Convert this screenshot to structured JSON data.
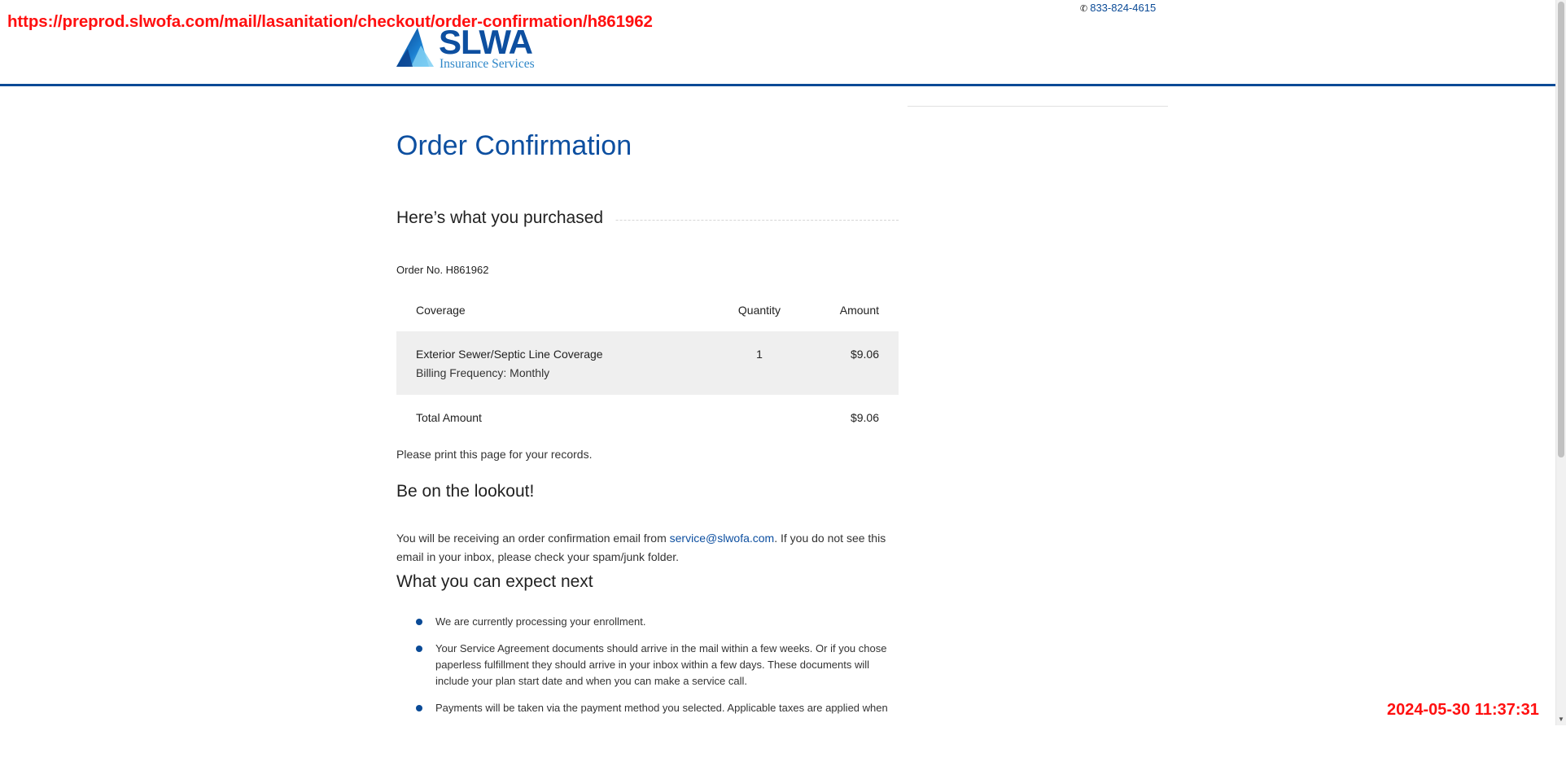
{
  "overlay": {
    "url": "https://preprod.slwofa.com/mail/lasanitation/checkout/order-confirmation/h861962",
    "timestamp": "2024-05-30 11:37:31"
  },
  "header": {
    "logo_text": "SLWA",
    "logo_subtitle": "Insurance Services",
    "phone": "833-824-4615",
    "accent_color": "#0a4a96"
  },
  "main": {
    "title": "Order Confirmation",
    "purchased_heading": "Here’s what you purchased",
    "order_no": "Order No. H861962",
    "table": {
      "columns": [
        "Coverage",
        "Quantity",
        "Amount"
      ],
      "items": [
        {
          "coverage": "Exterior Sewer/Septic Line Coverage",
          "billing": "Billing Frequency: Monthly",
          "quantity": "1",
          "amount": "$9.06"
        }
      ],
      "total_label": "Total Amount",
      "total_amount": "$9.06"
    },
    "print_note": "Please print this page for your records.",
    "lookout_heading": "Be on the lookout!",
    "lookout_text_before": "You will be receiving an order confirmation email from ",
    "lookout_email": "service@slwofa.com",
    "lookout_text_after": ". If you do not see this email in your inbox, please check your spam/junk folder.",
    "next_heading": "What you can expect next",
    "next_items": [
      "We are currently processing your enrollment.",
      "Your Service Agreement documents should arrive in the mail within a few weeks. Or if you chose paperless fulfillment they should arrive in your inbox within a few days. These documents will include your plan start date and when you can make a service call.",
      "Payments will be taken via the payment method you selected. Applicable taxes are applied when"
    ]
  }
}
